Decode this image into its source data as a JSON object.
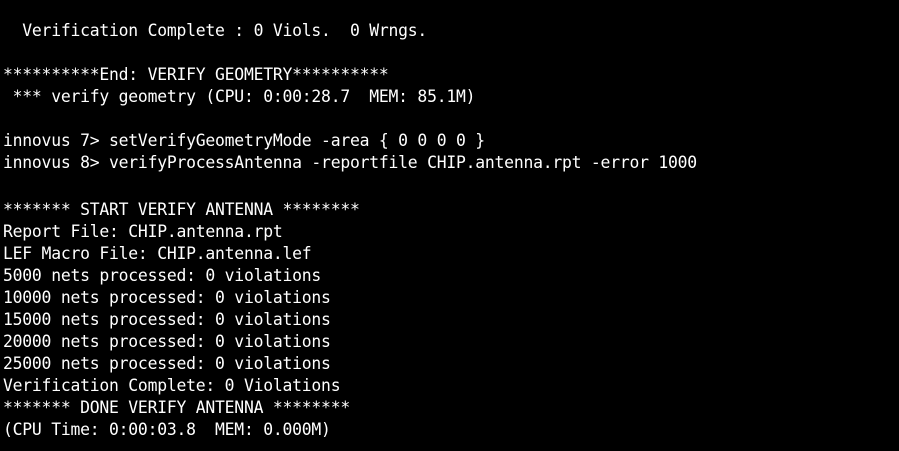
{
  "terminal": {
    "background_color": "#000000",
    "text_color": "#ffffff",
    "lines": [
      "  Verification Complete : 0 Viols.  0 Wrngs.",
      "",
      "**********End: VERIFY GEOMETRY**********",
      " *** verify geometry (CPU: 0:00:28.7  MEM: 85.1M)",
      "",
      "innovus 7> setVerifyGeometryMode -area { 0 0 0 0 }",
      "innovus 8> verifyProcessAntenna -reportfile CHIP.antenna.rpt -error 1000",
      "",
      "******* START VERIFY ANTENNA ********",
      "Report File: CHIP.antenna.rpt",
      "LEF Macro File: CHIP.antenna.lef",
      "5000 nets processed: 0 violations",
      "10000 nets processed: 0 violations",
      "15000 nets processed: 0 violations",
      "20000 nets processed: 0 violations",
      "25000 nets processed: 0 violations",
      "Verification Complete: 0 Violations",
      "******* DONE VERIFY ANTENNA ********",
      "(CPU Time: 0:00:03.8  MEM: 0.000M)"
    ]
  }
}
